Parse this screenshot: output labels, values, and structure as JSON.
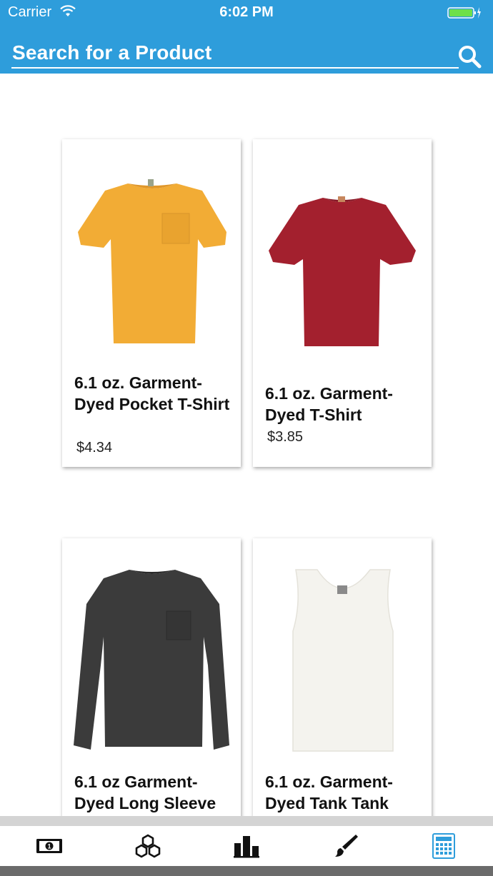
{
  "status_bar": {
    "carrier": "Carrier",
    "time": "6:02 PM"
  },
  "header": {
    "search_placeholder": "Search for a Product",
    "accent": "#2e9ddb"
  },
  "products": [
    {
      "title": "6.1 oz. Garment-Dyed Pocket T-Shirt",
      "price": "$4.34",
      "color": "#f2ac35"
    },
    {
      "title": "6.1 oz. Garment-Dyed T-Shirt",
      "price": "$3.85",
      "color": "#a3202e"
    },
    {
      "title": "6.1 oz Garment-Dyed Long Sleeve",
      "price": "",
      "color": "#3b3b3b"
    },
    {
      "title": "6.1 oz. Garment-Dyed Tank Tank",
      "price": "",
      "color": "#f4f3ee"
    }
  ],
  "tabs": [
    {
      "icon": "money-icon"
    },
    {
      "icon": "cubes-icon"
    },
    {
      "icon": "bar-chart-icon"
    },
    {
      "icon": "paintbrush-icon"
    },
    {
      "icon": "calculator-icon",
      "active_color": "#2e9ddb"
    }
  ]
}
